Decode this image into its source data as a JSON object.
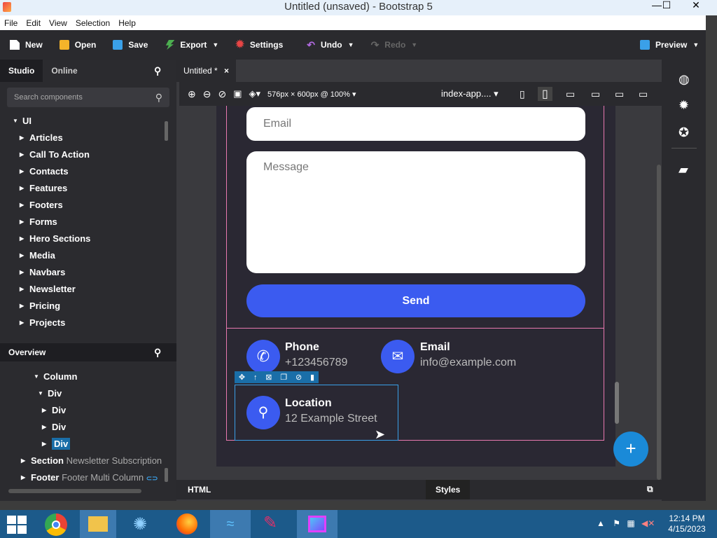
{
  "window": {
    "title": "Untitled (unsaved) - Bootstrap 5",
    "minimize": "—",
    "maximize": "☐",
    "close": "✕"
  },
  "menu": [
    "File",
    "Edit",
    "View",
    "Selection",
    "Help"
  ],
  "toolbar": {
    "new": "New",
    "open": "Open",
    "save": "Save",
    "export": "Export",
    "settings": "Settings",
    "undo": "Undo",
    "redo": "Redo",
    "preview": "Preview"
  },
  "sidebar": {
    "tabs": {
      "studio": "Studio",
      "online": "Online"
    },
    "search_placeholder": "Search components",
    "root": "UI",
    "items": [
      "Articles",
      "Call To Action",
      "Contacts",
      "Features",
      "Footers",
      "Forms",
      "Hero Sections",
      "Media",
      "Navbars",
      "Newsletter",
      "Pricing",
      "Projects"
    ],
    "overview_label": "Overview",
    "overview": {
      "column": "Column",
      "div": "Div",
      "child1": "Div",
      "child2": "Div",
      "child3": "Div",
      "section": "Section",
      "section_name": "Newsletter Subscription",
      "footer": "Footer",
      "footer_name": "Footer Multi Column"
    }
  },
  "doc": {
    "tab": "Untitled *",
    "tab_close": "×",
    "size": "576px × 600px @ 100%",
    "page": "index-app...."
  },
  "form": {
    "email_placeholder": "Email",
    "message_placeholder": "Message",
    "send": "Send"
  },
  "contacts": {
    "phone_title": "Phone",
    "phone_value": "+123456789",
    "email_title": "Email",
    "email_value": "info@example.com",
    "location_title": "Location",
    "location_value": "12 Example Street"
  },
  "fab": "+",
  "bottom": {
    "html": "HTML",
    "styles": "Styles"
  },
  "taskbar": {
    "time": "12:14 PM",
    "date": "4/15/2023"
  },
  "colors": {
    "accent": "#3b5bf0",
    "selection": "#e879b0",
    "fab": "#1a8ad8"
  }
}
